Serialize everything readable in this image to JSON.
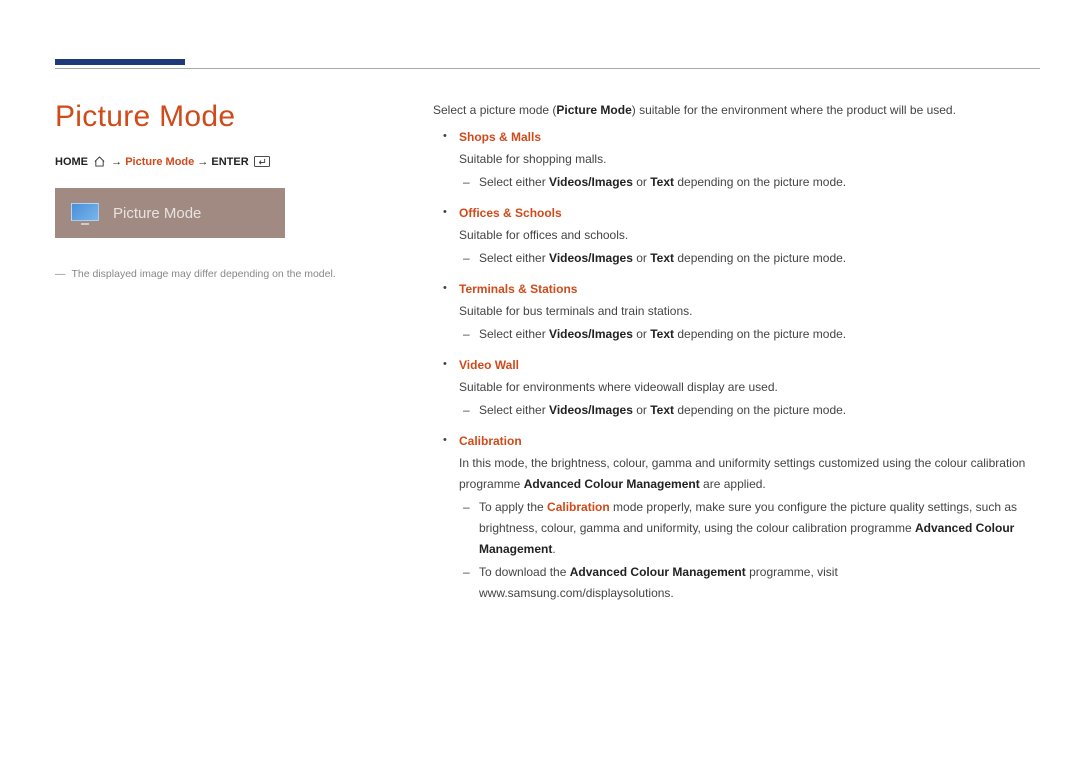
{
  "header": {
    "title": "Picture Mode"
  },
  "breadcrumb": {
    "home": "HOME",
    "arrow1": "→",
    "mid": "Picture Mode",
    "arrow2": "→",
    "enter": "ENTER"
  },
  "menu_preview": {
    "label": "Picture Mode"
  },
  "footnote": {
    "dash": "―",
    "text": "The displayed image may differ depending on the model."
  },
  "intro": {
    "pre": "Select a picture mode (",
    "kw": "Picture Mode",
    "post": ") suitable for the environment where the product will be used."
  },
  "common": {
    "select_pre": "Select either ",
    "vi": "Videos/Images",
    "or": " or ",
    "txt": "Text",
    "select_post": " depending on the picture mode."
  },
  "items": [
    {
      "title": "Shops & Malls",
      "desc": "Suitable for shopping malls.",
      "has_select": true
    },
    {
      "title": "Offices & Schools",
      "desc": "Suitable for offices and schools.",
      "has_select": true
    },
    {
      "title": "Terminals & Stations",
      "desc": "Suitable for bus terminals and train stations.",
      "has_select": true
    },
    {
      "title": "Video Wall",
      "desc": "Suitable for environments where videowall display are used.",
      "has_select": true
    }
  ],
  "calibration": {
    "title": "Calibration",
    "desc_pre": "In this mode, the brightness, colour, gamma and uniformity settings customized using the colour calibration programme ",
    "acm": "Advanced Colour Management",
    "desc_post": " are applied.",
    "note1_pre": "To apply the ",
    "note1_kw": "Calibration",
    "note1_mid": " mode properly, make sure you configure the picture quality settings, such as brightness, colour, gamma and uniformity, using the colour calibration programme ",
    "note1_post": ".",
    "note2_pre": "To download the ",
    "note2_post": " programme, visit www.samsung.com/displaysolutions."
  }
}
